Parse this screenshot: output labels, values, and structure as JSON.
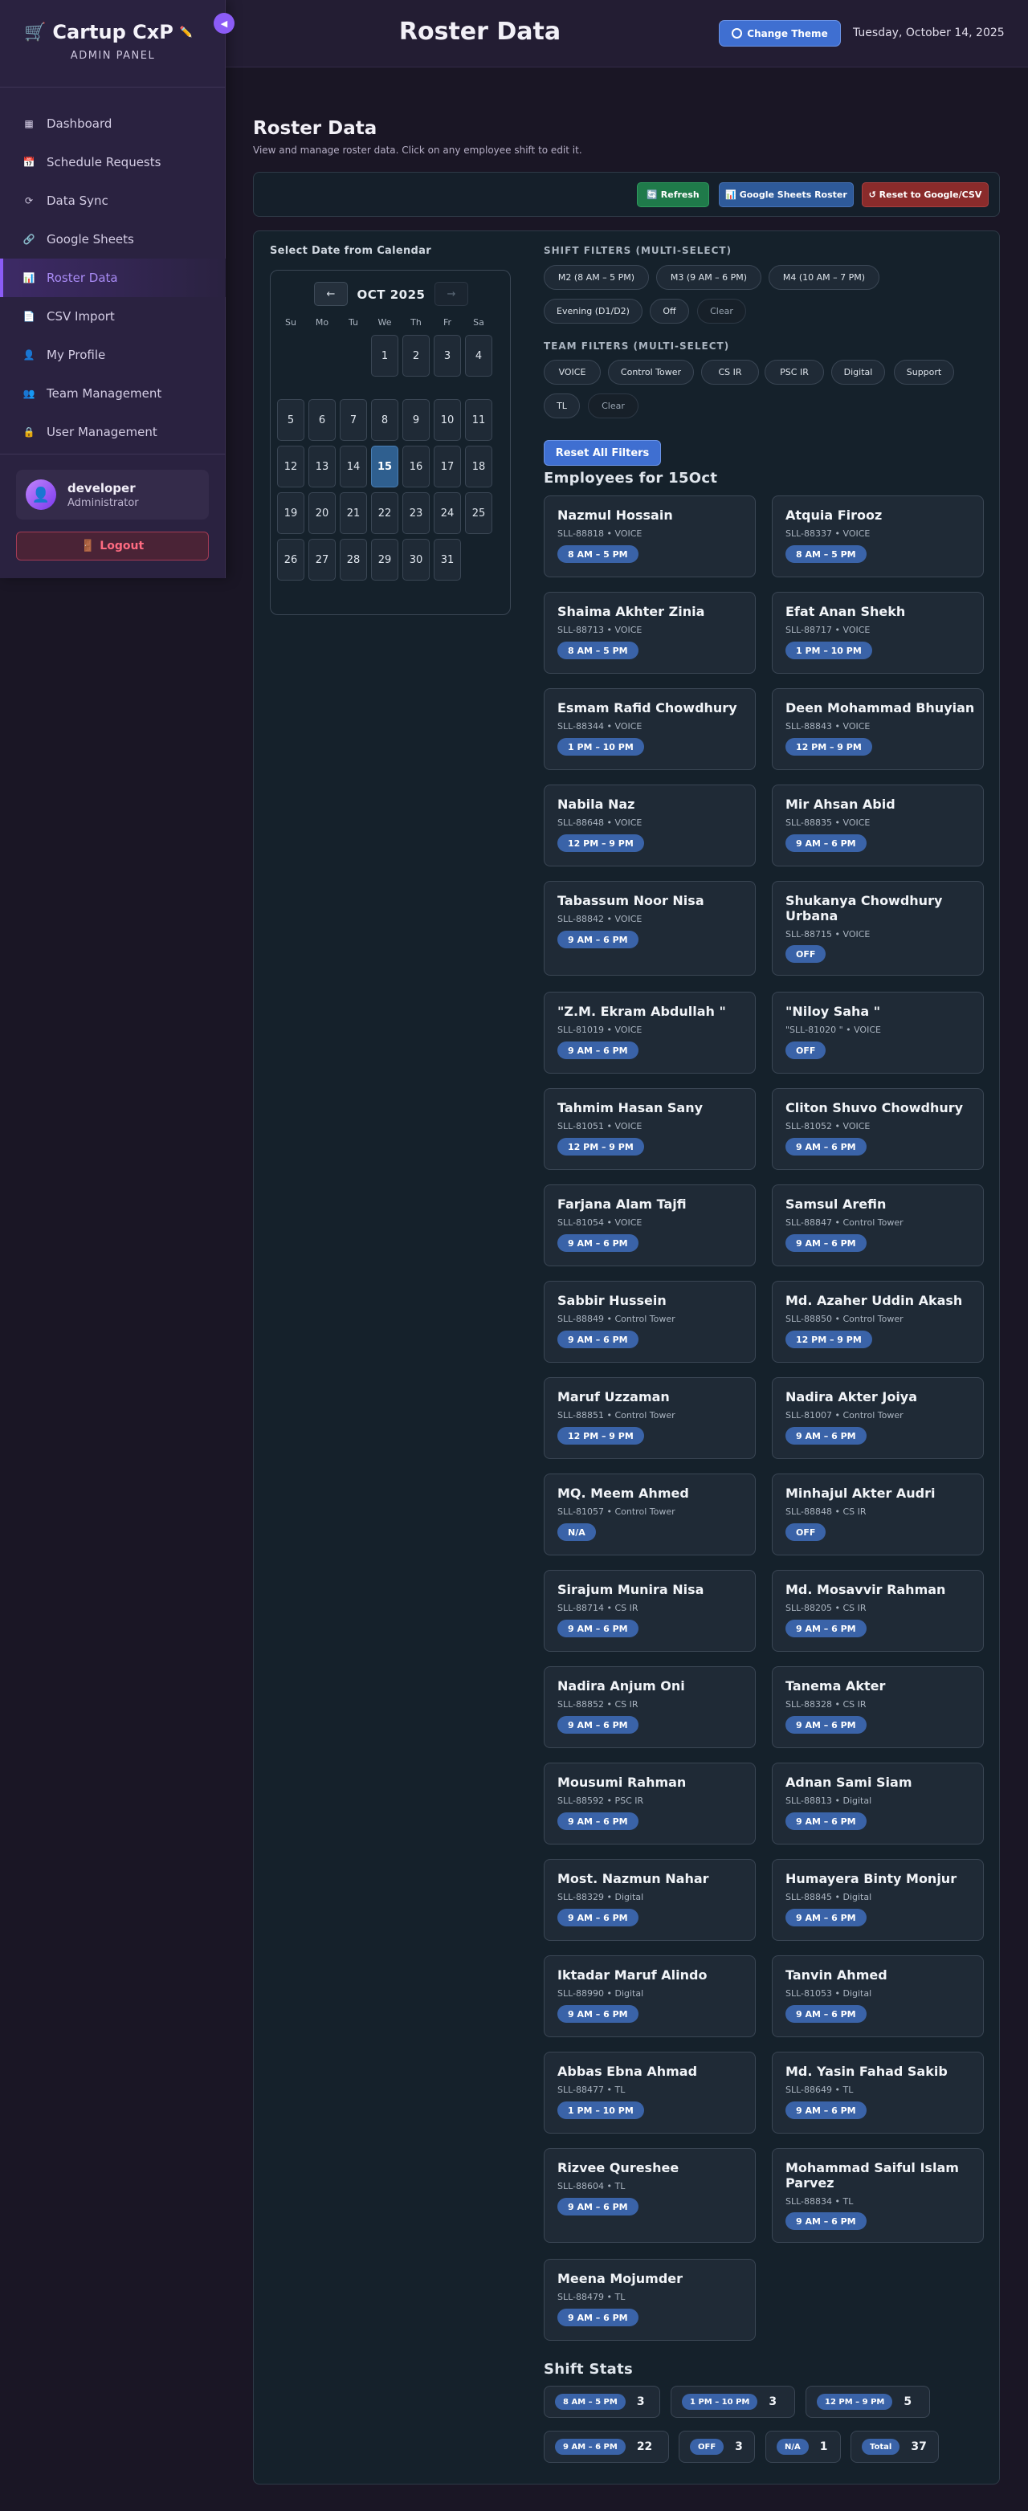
{
  "header": {
    "title": "Roster Data",
    "change_theme_label": "Change Theme",
    "date": "Tuesday, October 14, 2025"
  },
  "sidebar": {
    "brand": "Cartup CxP",
    "subtitle": "ADMIN PANEL",
    "collapse_icon": "chevron-left-icon",
    "items": [
      {
        "label": "Dashboard",
        "icon": "dashboard-icon"
      },
      {
        "label": "Schedule Requests",
        "icon": "calendar-icon"
      },
      {
        "label": "Data Sync",
        "icon": "sync-icon"
      },
      {
        "label": "Google Sheets",
        "icon": "link-icon"
      },
      {
        "label": "Roster Data",
        "icon": "bar-chart-icon",
        "active": true
      },
      {
        "label": "CSV Import",
        "icon": "file-import-icon"
      },
      {
        "label": "My Profile",
        "icon": "user-icon"
      },
      {
        "label": "Team Management",
        "icon": "team-icon"
      },
      {
        "label": "User Management",
        "icon": "lock-icon"
      }
    ],
    "user": {
      "name": "developer",
      "role": "Administrator"
    },
    "logout_label": "Logout"
  },
  "main": {
    "title": "Roster Data",
    "subtitle": "View and manage roster data. Click on any employee shift to edit it.",
    "actions": {
      "refresh": "🔄 Refresh",
      "sheets": "📊 Google Sheets Roster",
      "reset": "↺ Reset to Google/CSV"
    },
    "calendar": {
      "label": "Select Date from Calendar",
      "prev": "←",
      "next": "→",
      "month": "OCT 2025",
      "weekdays": [
        "Su",
        "Mo",
        "Tu",
        "We",
        "Th",
        "Fr",
        "Sa"
      ],
      "first_weekday": 3,
      "days_in_month": 31,
      "selected_day": 15
    },
    "shift_filters": {
      "label": "SHIFT FILTERS (MULTI-SELECT)",
      "options": [
        "M2 (8 AM – 5 PM)",
        "M3 (9 AM – 6 PM)",
        "M4 (10 AM – 7 PM)",
        "Evening (D1/D2)",
        "Off",
        "Clear"
      ]
    },
    "team_filters": {
      "label": "TEAM FILTERS (MULTI-SELECT)",
      "options": [
        "VOICE",
        "Control Tower",
        "CS IR",
        "PSC IR",
        "Digital",
        "Support",
        "TL",
        "Clear"
      ]
    },
    "reset_filters_label": "Reset All Filters",
    "employees_heading": "Employees for 15Oct",
    "employees": [
      {
        "name": "Nazmul Hossain",
        "meta": "SLL-88818 • VOICE",
        "shift": "8 AM – 5 PM"
      },
      {
        "name": "Atquia Firooz",
        "meta": "SLL-88337 • VOICE",
        "shift": "8 AM – 5 PM"
      },
      {
        "name": "Shaima Akhter Zinia",
        "meta": "SLL-88713 • VOICE",
        "shift": "8 AM – 5 PM"
      },
      {
        "name": "Efat Anan Shekh",
        "meta": "SLL-88717 • VOICE",
        "shift": "1 PM – 10 PM"
      },
      {
        "name": "Esmam Rafid Chowdhury",
        "meta": "SLL-88344 • VOICE",
        "shift": "1 PM – 10 PM"
      },
      {
        "name": "Deen Mohammad Bhuyian",
        "meta": "SLL-88843 • VOICE",
        "shift": "12 PM – 9 PM"
      },
      {
        "name": "Nabila Naz",
        "meta": "SLL-88648 • VOICE",
        "shift": "12 PM – 9 PM"
      },
      {
        "name": "Mir Ahsan Abid",
        "meta": "SLL-88835 • VOICE",
        "shift": "9 AM – 6 PM"
      },
      {
        "name": "Tabassum Noor Nisa",
        "meta": "SLL-88842 • VOICE",
        "shift": "9 AM – 6 PM"
      },
      {
        "name": "Shukanya Chowdhury Urbana",
        "meta": "SLL-88715 • VOICE",
        "shift": "OFF"
      },
      {
        "name": "\"Z.M. Ekram Abdullah \"",
        "meta": "SLL-81019 • VOICE",
        "shift": "9 AM – 6 PM"
      },
      {
        "name": "\"Niloy Saha \"",
        "meta": "\"SLL-81020 \" • VOICE",
        "shift": "OFF"
      },
      {
        "name": "Tahmim Hasan Sany",
        "meta": "SLL-81051 • VOICE",
        "shift": "12 PM – 9 PM"
      },
      {
        "name": "Cliton Shuvo Chowdhury",
        "meta": "SLL-81052 • VOICE",
        "shift": "9 AM – 6 PM"
      },
      {
        "name": "Farjana Alam Tajfi",
        "meta": "SLL-81054 • VOICE",
        "shift": "9 AM – 6 PM"
      },
      {
        "name": "Samsul Arefin",
        "meta": "SLL-88847 • Control Tower",
        "shift": "9 AM – 6 PM"
      },
      {
        "name": "Sabbir Hussein",
        "meta": "SLL-88849 • Control Tower",
        "shift": "9 AM – 6 PM"
      },
      {
        "name": "Md. Azaher Uddin Akash",
        "meta": "SLL-88850 • Control Tower",
        "shift": "12 PM – 9 PM"
      },
      {
        "name": "Maruf Uzzaman",
        "meta": "SLL-88851 • Control Tower",
        "shift": "12 PM – 9 PM"
      },
      {
        "name": "Nadira Akter Joiya",
        "meta": "SLL-81007 • Control Tower",
        "shift": "9 AM – 6 PM"
      },
      {
        "name": "MQ. Meem Ahmed",
        "meta": "SLL-81057 • Control Tower",
        "shift": "N/A"
      },
      {
        "name": "Minhajul Akter Audri",
        "meta": "SLL-88848 • CS IR",
        "shift": "OFF"
      },
      {
        "name": "Sirajum Munira Nisa",
        "meta": "SLL-88714 • CS IR",
        "shift": "9 AM – 6 PM"
      },
      {
        "name": "Md. Mosavvir Rahman",
        "meta": "SLL-88205 • CS IR",
        "shift": "9 AM – 6 PM"
      },
      {
        "name": "Nadira Anjum Oni",
        "meta": "SLL-88852 • CS IR",
        "shift": "9 AM – 6 PM"
      },
      {
        "name": "Tanema Akter",
        "meta": "SLL-88328 • CS IR",
        "shift": "9 AM – 6 PM"
      },
      {
        "name": "Mousumi Rahman",
        "meta": "SLL-88592 • PSC IR",
        "shift": "9 AM – 6 PM"
      },
      {
        "name": "Adnan Sami Siam",
        "meta": "SLL-88813 • Digital",
        "shift": "9 AM – 6 PM"
      },
      {
        "name": "Most. Nazmun Nahar",
        "meta": "SLL-88329 • Digital",
        "shift": "9 AM – 6 PM"
      },
      {
        "name": "Humayera Binty Monjur",
        "meta": "SLL-88845 • Digital",
        "shift": "9 AM – 6 PM"
      },
      {
        "name": "Iktadar Maruf Alindo",
        "meta": "SLL-88990 • Digital",
        "shift": "9 AM – 6 PM"
      },
      {
        "name": "Tanvin Ahmed",
        "meta": "SLL-81053 • Digital",
        "shift": "9 AM – 6 PM"
      },
      {
        "name": "Abbas Ebna Ahmad",
        "meta": "SLL-88477 • TL",
        "shift": "1 PM – 10 PM"
      },
      {
        "name": "Md. Yasin Fahad Sakib",
        "meta": "SLL-88649 • TL",
        "shift": "9 AM – 6 PM"
      },
      {
        "name": "Rizvee Qureshee",
        "meta": "SLL-88604 • TL",
        "shift": "9 AM – 6 PM"
      },
      {
        "name": "Mohammad Saiful Islam Parvez",
        "meta": "SLL-88834 • TL",
        "shift": "9 AM – 6 PM"
      },
      {
        "name": "Meena Mojumder",
        "meta": "SLL-88479 • TL",
        "shift": "9 AM – 6 PM"
      }
    ],
    "stats_heading": "Shift Stats",
    "stats": [
      {
        "label": "8 AM – 5 PM",
        "value": "3"
      },
      {
        "label": "1 PM – 10 PM",
        "value": "3"
      },
      {
        "label": "12 PM – 9 PM",
        "value": "5"
      },
      {
        "label": "9 AM – 6 PM",
        "value": "22"
      },
      {
        "label": "OFF",
        "value": "3"
      },
      {
        "label": "N/A",
        "value": "1"
      },
      {
        "label": "Total",
        "value": "37"
      }
    ]
  }
}
